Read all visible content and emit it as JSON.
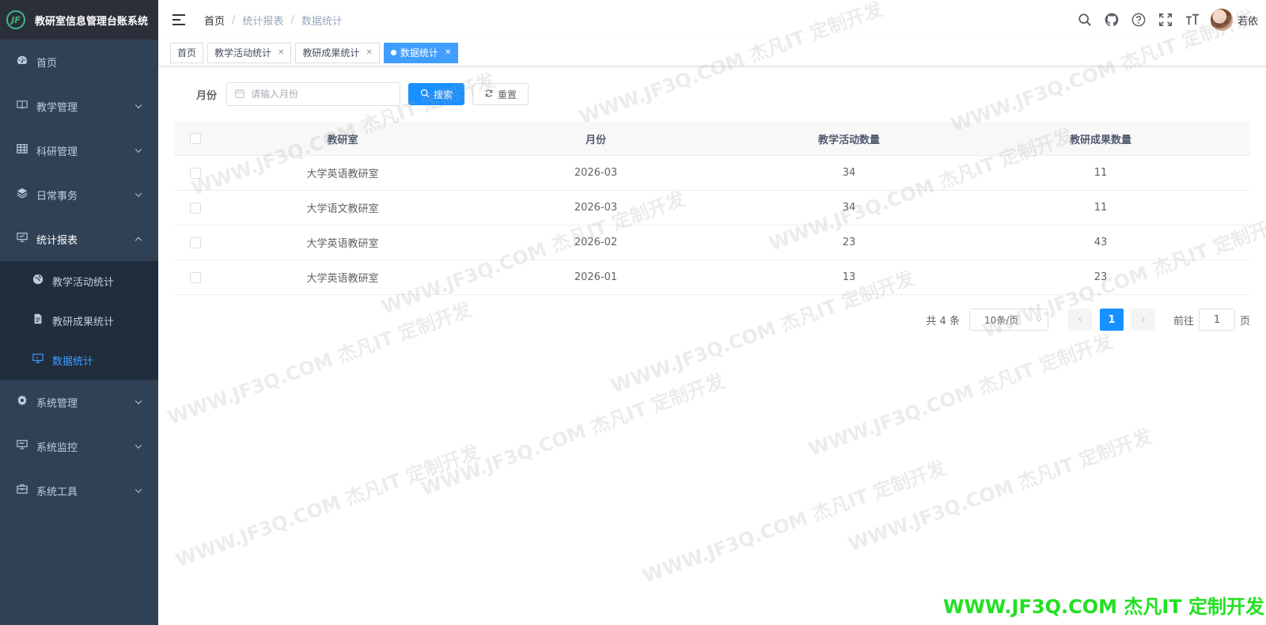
{
  "app": {
    "title": "教研室信息管理台账系统",
    "logo_text": "JF",
    "accent": "#409eff",
    "sidebar_bg": "#304156"
  },
  "sidebar": {
    "items": [
      {
        "label": "首页",
        "icon": "dashboard-icon"
      },
      {
        "label": "教学管理",
        "icon": "book-icon"
      },
      {
        "label": "科研管理",
        "icon": "grid-icon"
      },
      {
        "label": "日常事务",
        "icon": "layers-icon"
      },
      {
        "label": "统计报表",
        "icon": "monitor-icon",
        "expanded": true
      },
      {
        "label": "系统管理",
        "icon": "gear-icon"
      },
      {
        "label": "系统监控",
        "icon": "monitor-icon"
      },
      {
        "label": "系统工具",
        "icon": "toolbox-icon"
      }
    ],
    "sub_items": [
      {
        "label": "教学活动统计",
        "icon": "globe-icon"
      },
      {
        "label": "教研成果统计",
        "icon": "document-icon"
      },
      {
        "label": "数据统计",
        "icon": "monitor-icon",
        "active": true
      }
    ]
  },
  "navbar": {
    "breadcrumb": [
      "首页",
      "统计报表",
      "数据统计"
    ],
    "icons": [
      "search-icon",
      "github-icon",
      "question-icon",
      "fullscreen-icon",
      "font-size-icon"
    ],
    "user_name": "若依"
  },
  "tags": [
    {
      "label": "首页"
    },
    {
      "label": "教学活动统计"
    },
    {
      "label": "教研成果统计"
    },
    {
      "label": "数据统计",
      "active": true
    }
  ],
  "search": {
    "month_label": "月份",
    "month_placeholder": "请输入月份",
    "search_button": "搜索",
    "reset_button": "重置"
  },
  "table": {
    "headers": [
      "教研室",
      "月份",
      "教学活动数量",
      "教研成果数量"
    ],
    "rows": [
      [
        "大学英语教研室",
        "2026-03",
        "34",
        "11"
      ],
      [
        "大学语文教研室",
        "2026-03",
        "34",
        "11"
      ],
      [
        "大学英语教研室",
        "2026-02",
        "23",
        "43"
      ],
      [
        "大学英语教研室",
        "2026-01",
        "13",
        "23"
      ]
    ]
  },
  "pagination": {
    "total": "共 4 条",
    "page_size": "10条/页",
    "current_page": "1",
    "goto_label": "前往",
    "goto_value": "1",
    "page_unit": "页"
  },
  "watermark": {
    "text": "WWW.JF3Q.COM 杰凡IT  定制开发",
    "corner_text": "WWW.JF3Q.COM 杰凡IT  定制开发"
  }
}
